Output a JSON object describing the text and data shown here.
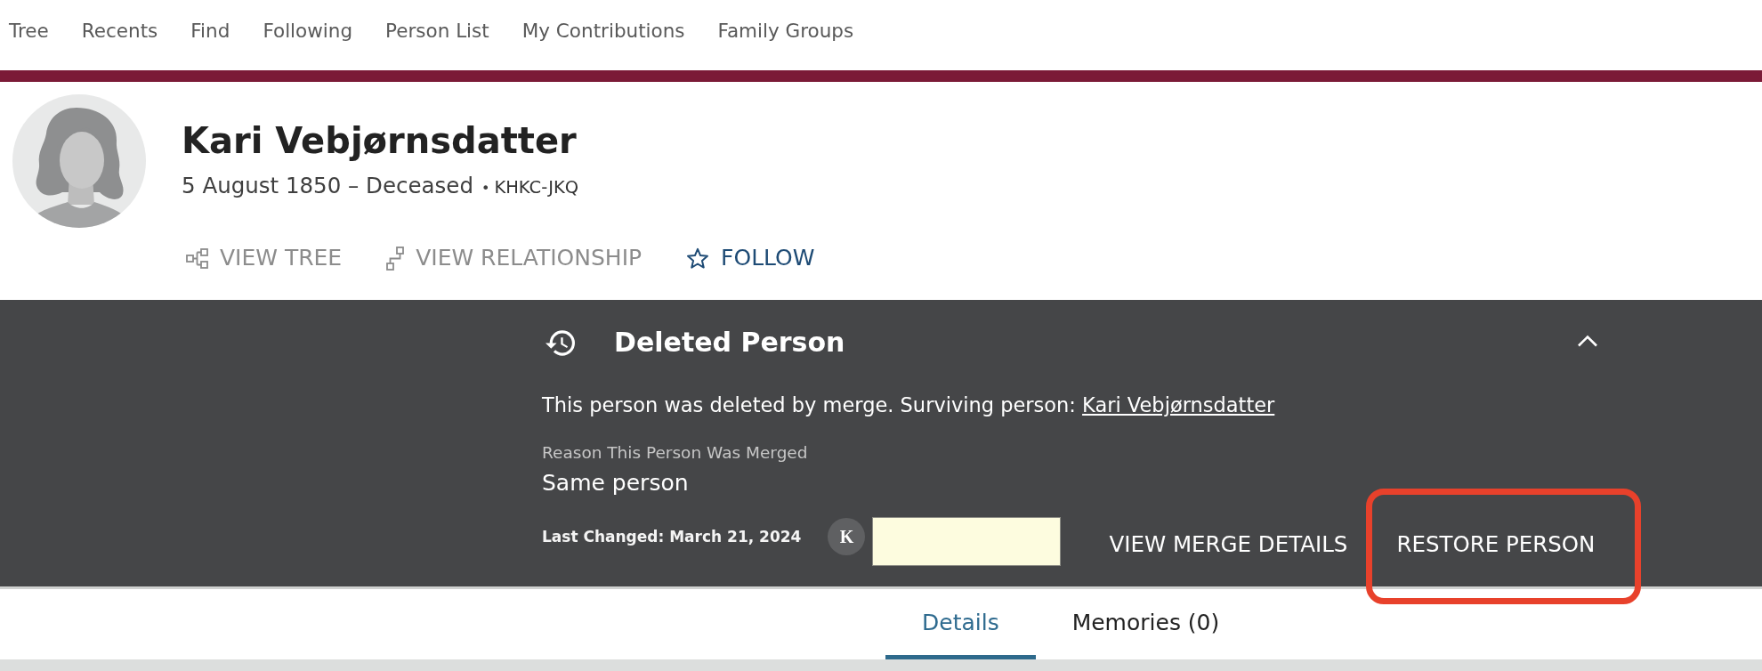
{
  "nav": [
    "Tree",
    "Recents",
    "Find",
    "Following",
    "Person List",
    "My Contributions",
    "Family Groups"
  ],
  "person": {
    "name": "Kari Vebjørnsdatter",
    "lifespan": "5 August 1850 – Deceased",
    "separator": "•",
    "person_id": "KHKC-JKQ",
    "actions": [
      {
        "kind": "tree",
        "label": "VIEW TREE",
        "disabled": true
      },
      {
        "kind": "relationship",
        "label": "VIEW RELATIONSHIP",
        "disabled": true
      },
      {
        "kind": "follow",
        "label": "FOLLOW",
        "disabled": false
      }
    ]
  },
  "banner": {
    "title": "Deleted Person",
    "expanded": true,
    "message": "This person was deleted by merge. Surviving person:",
    "surviving_person_link": "Kari Vebjørnsdatter",
    "reason_label": "Reason This Person Was Merged",
    "reason": "Same person",
    "last_changed": "Last Changed: March 21, 2024",
    "contributor_initial": "K",
    "actions": [
      {
        "label": "VIEW MERGE DETAILS",
        "annotated": false
      },
      {
        "label": "RESTORE PERSON",
        "annotated": true
      }
    ]
  },
  "tabs": [
    {
      "label": "Details",
      "selected": true
    },
    {
      "label": "Memories (0)",
      "selected": false
    }
  ]
}
